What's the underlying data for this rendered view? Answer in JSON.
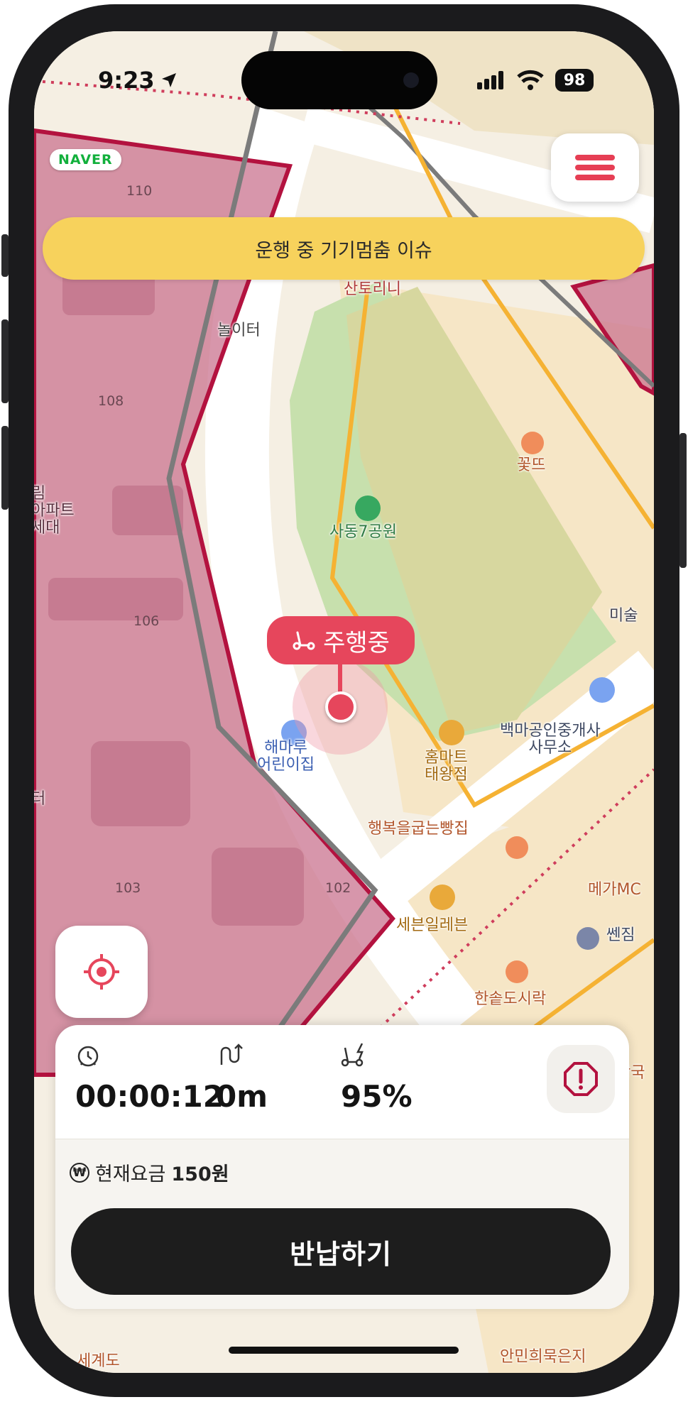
{
  "status_bar": {
    "time": "9:23",
    "battery": "98"
  },
  "map": {
    "provider": "NAVER",
    "labels": {
      "santorini": "산토리니",
      "playground": "놀이터",
      "kkotteu": "꽃뜨",
      "park": "사동7공원",
      "art": "미술",
      "office": "백마공인중개사\n사무소",
      "daycare": "해마루\n어린이집",
      "homemart": "홈마트\n태왕점",
      "bakery": "행복을굽는빵집",
      "mega": "메가MC",
      "seven": "세븐일레븐",
      "ssenjip": "쎈짐",
      "hansot": "한솥도시락",
      "apt": "림\n아파트\n세대",
      "edge_teo": "터",
      "right_guk": "왕국",
      "bottom_right": "안민희묵은지",
      "bottom_left": "세계도"
    },
    "building_numbers": [
      "110",
      "108",
      "106",
      "103",
      "102"
    ]
  },
  "header": {
    "notice": "운행 중 기기멈춤 이슈"
  },
  "riding_marker": {
    "label": "주행중"
  },
  "ride_panel": {
    "time": "00:00:12",
    "distance": "0m",
    "battery": "95%",
    "fare_label": "현재요금",
    "fare_value": "150원",
    "won_symbol": "₩",
    "return_label": "반납하기"
  },
  "colors": {
    "accent": "#e6465c",
    "restricted_zone": "#c63d5e",
    "notice_bg": "#f7d25c",
    "park": "#dbd8a3",
    "road_outline": "#f7b733"
  }
}
